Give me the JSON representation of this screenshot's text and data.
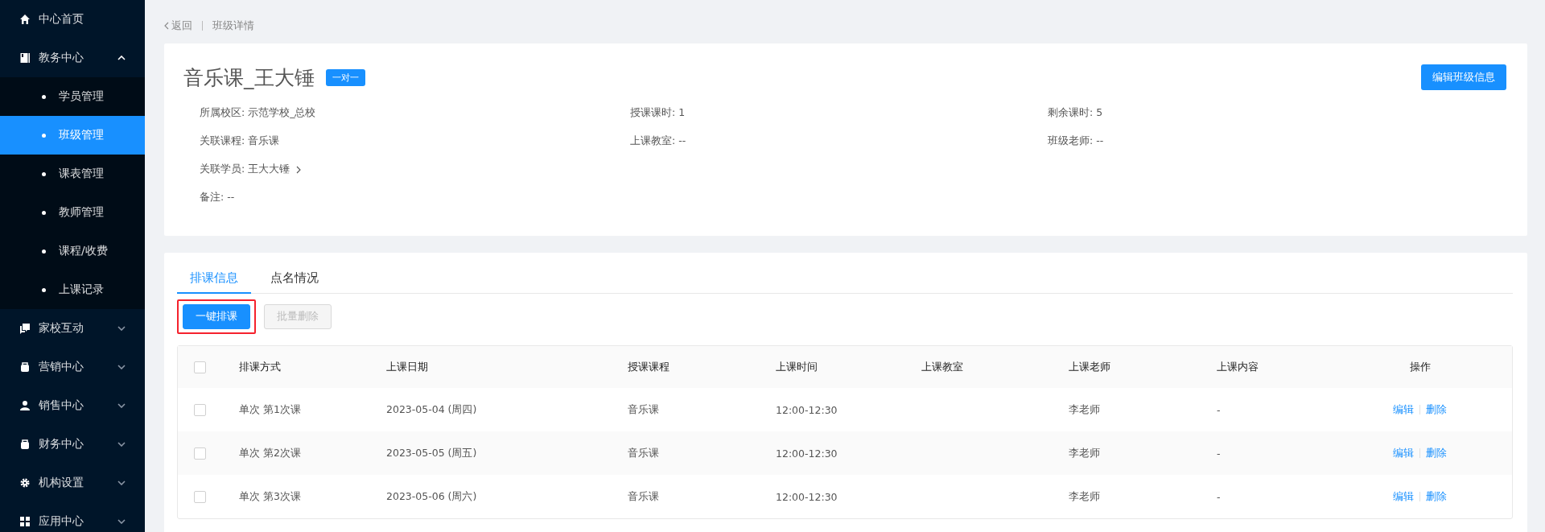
{
  "sidebar": {
    "items": [
      {
        "label": "中心首页",
        "selected": false
      },
      {
        "label": "教务中心",
        "selected": false,
        "expanded": true,
        "children": [
          {
            "label": "学员管理",
            "selected": false
          },
          {
            "label": "班级管理",
            "selected": true
          },
          {
            "label": "课表管理",
            "selected": false
          },
          {
            "label": "教师管理",
            "selected": false
          },
          {
            "label": "课程/收费",
            "selected": false
          },
          {
            "label": "上课记录",
            "selected": false
          }
        ]
      },
      {
        "label": "家校互动",
        "selected": false,
        "expanded": false
      },
      {
        "label": "营销中心",
        "selected": false,
        "expanded": false
      },
      {
        "label": "销售中心",
        "selected": false,
        "expanded": false
      },
      {
        "label": "财务中心",
        "selected": false,
        "expanded": false
      },
      {
        "label": "机构设置",
        "selected": false,
        "expanded": false
      },
      {
        "label": "应用中心",
        "selected": false,
        "expanded": false
      }
    ]
  },
  "breadcrumb": {
    "back": "返回",
    "current": "班级详情"
  },
  "class_card": {
    "title": "音乐课_王大锤",
    "tag": "一对一",
    "edit_button": "编辑班级信息",
    "info_rows": [
      [
        {
          "kind": "text",
          "label": "所属校区:",
          "value": "示范学校_总校"
        },
        {
          "kind": "text",
          "label": "授课课时:",
          "value": "1"
        },
        {
          "kind": "text",
          "label": "剩余课时:",
          "value": "5"
        }
      ],
      [
        {
          "kind": "text",
          "label": "关联课程:",
          "value": "音乐课"
        },
        {
          "kind": "text",
          "label": "上课教室:",
          "value": "--"
        },
        {
          "kind": "text",
          "label": "班级老师:",
          "value": "--"
        }
      ],
      [
        {
          "kind": "link",
          "label": "关联学员:",
          "value": "王大大锤"
        }
      ],
      [
        {
          "kind": "text",
          "label": "备注:",
          "value": "--"
        }
      ]
    ]
  },
  "tabs": [
    {
      "label": "排课信息",
      "selected": true
    },
    {
      "label": "点名情况",
      "selected": false
    }
  ],
  "toolbar": [
    {
      "label": "一键排课",
      "kind": "primary",
      "disabled": false,
      "highlighted": true
    },
    {
      "label": "批量删除",
      "kind": "default",
      "disabled": true,
      "highlighted": false
    }
  ],
  "table": {
    "select_all_checked": false,
    "columns": [
      "排课方式",
      "上课日期",
      "授课课程",
      "上课时间",
      "上课教室",
      "上课老师",
      "上课内容",
      "操作"
    ],
    "rows": [
      {
        "checked": false,
        "cells": [
          "单次 第1次课",
          "2023-05-04 (周四)",
          "音乐课",
          "12:00-12:30",
          "",
          "李老师",
          "-"
        ],
        "actions": [
          "编辑",
          "删除"
        ]
      },
      {
        "checked": false,
        "cells": [
          "单次 第2次课",
          "2023-05-05 (周五)",
          "音乐课",
          "12:00-12:30",
          "",
          "李老师",
          "-"
        ],
        "actions": [
          "编辑",
          "删除"
        ]
      },
      {
        "checked": false,
        "cells": [
          "单次 第3次课",
          "2023-05-06 (周六)",
          "音乐课",
          "12:00-12:30",
          "",
          "李老师",
          "-"
        ],
        "actions": [
          "编辑",
          "删除"
        ]
      }
    ]
  }
}
